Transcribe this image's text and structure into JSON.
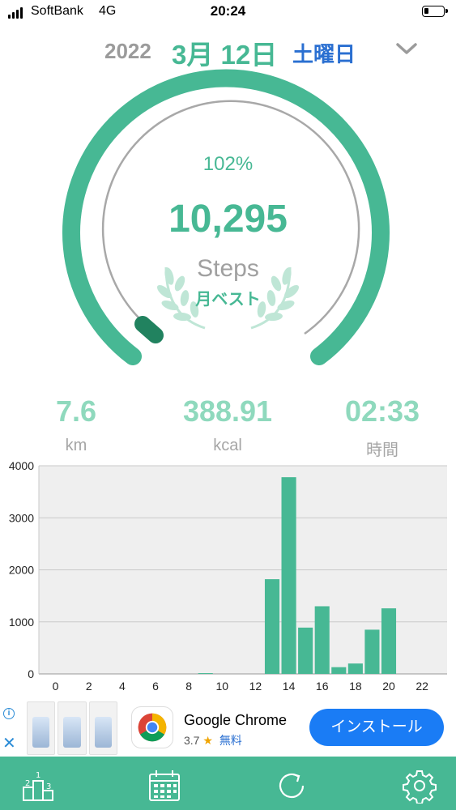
{
  "status_bar": {
    "carrier": "SoftBank",
    "network": "4G",
    "time": "20:24"
  },
  "date": {
    "year": "2022",
    "month_day": "3月 12日",
    "weekday": "土曜日"
  },
  "gauge": {
    "percent": "102%",
    "steps": "10,295",
    "steps_label": "Steps",
    "badge": "月ベスト",
    "progress_fraction": 1.02
  },
  "stats": [
    {
      "value": "7.6",
      "label": "km"
    },
    {
      "value": "388.91",
      "label": "kcal"
    },
    {
      "value": "02:33",
      "label": "時間"
    }
  ],
  "chart_data": {
    "type": "bar",
    "x_ticks": [
      "0",
      "2",
      "4",
      "6",
      "8",
      "10",
      "12",
      "14",
      "16",
      "18",
      "20",
      "22"
    ],
    "y_ticks": [
      "0",
      "1000",
      "2000",
      "3000",
      "4000"
    ],
    "ylim": [
      0,
      4000
    ],
    "xlim": [
      -1,
      23.5
    ],
    "hours": [
      0,
      1,
      2,
      3,
      4,
      5,
      6,
      7,
      8,
      9,
      10,
      11,
      12,
      13,
      14,
      15,
      16,
      17,
      18,
      19,
      20,
      21,
      22,
      23
    ],
    "values": [
      0,
      0,
      0,
      0,
      0,
      0,
      0,
      0,
      0,
      15,
      0,
      0,
      0,
      1820,
      3780,
      890,
      1300,
      130,
      200,
      850,
      1260,
      0,
      0,
      0
    ],
    "grid": true,
    "bar_color": "#47b894"
  },
  "ad": {
    "app_name": "Google Chrome",
    "rating": "3.7",
    "price": "無料",
    "install_label": "インストール"
  },
  "colors": {
    "accent": "#47b894",
    "accent_light": "#8fd9bd",
    "weekday_blue": "#2a6fd1"
  }
}
